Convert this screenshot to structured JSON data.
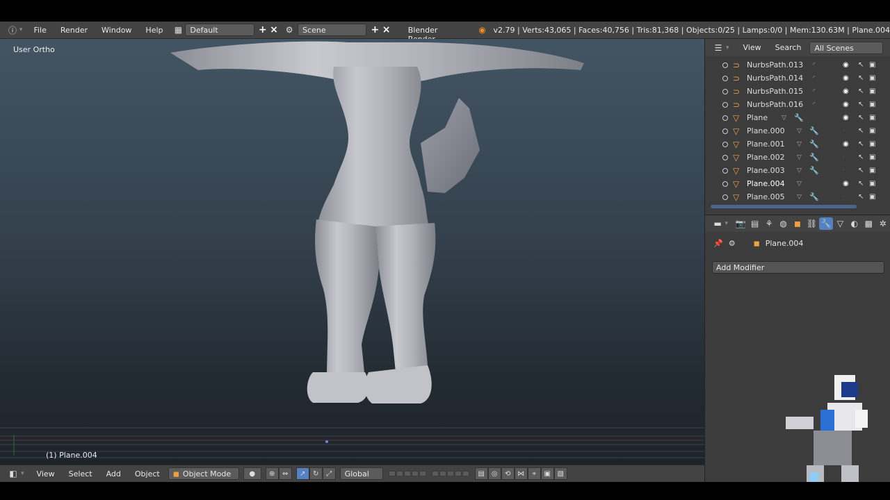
{
  "header": {
    "menus": [
      "File",
      "Render",
      "Window",
      "Help"
    ],
    "layout_name": "Default",
    "scene_name": "Scene",
    "render_engine": "Blender Render",
    "stats": "v2.79 | Verts:43,065 | Faces:40,756 | Tris:81,368 | Objects:0/25 | Lamps:0/0 | Mem:130.63M | Plane.004"
  },
  "viewport": {
    "view_label": "User Ortho",
    "active_object_label": "(1) Plane.004"
  },
  "viewport_header": {
    "menus": [
      "View",
      "Select",
      "Add",
      "Object"
    ],
    "mode": "Object Mode",
    "orientation": "Global"
  },
  "outliner": {
    "menus": [
      "View",
      "Search"
    ],
    "display_mode": "All Scenes",
    "items": [
      {
        "name": "NurbsPath.013",
        "type": "curve",
        "visible": true
      },
      {
        "name": "NurbsPath.014",
        "type": "curve",
        "visible": true
      },
      {
        "name": "NurbsPath.015",
        "type": "curve",
        "visible": true
      },
      {
        "name": "NurbsPath.016",
        "type": "curve",
        "visible": true
      },
      {
        "name": "Plane",
        "type": "mesh",
        "visible": true
      },
      {
        "name": "Plane.000",
        "type": "mesh",
        "visible": false
      },
      {
        "name": "Plane.001",
        "type": "mesh",
        "visible": true
      },
      {
        "name": "Plane.002",
        "type": "mesh",
        "visible": false
      },
      {
        "name": "Plane.003",
        "type": "mesh",
        "visible": false
      },
      {
        "name": "Plane.004",
        "type": "mesh",
        "visible": true,
        "selected": true
      },
      {
        "name": "Plane.005",
        "type": "mesh",
        "visible": false
      }
    ]
  },
  "properties": {
    "context_object": "Plane.004",
    "add_modifier_label": "Add Modifier"
  },
  "colors": {
    "header_bg": "#434343",
    "panel_bg": "#3c3c3c",
    "accent_blue": "#5680c2",
    "object_orange": "#f0a040"
  }
}
